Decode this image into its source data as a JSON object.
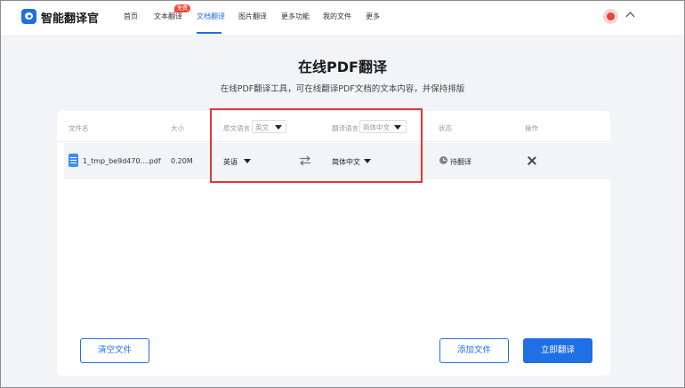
{
  "header": {
    "logo": "智能翻译官",
    "nav": [
      {
        "label": "首页"
      },
      {
        "label": "文本翻译"
      },
      {
        "label": "文档翻译"
      },
      {
        "label": "图片翻译"
      },
      {
        "label": "更多功能"
      },
      {
        "label": "我的文件"
      },
      {
        "label": "更多"
      }
    ],
    "badge": "免费"
  },
  "page": {
    "title": "在线PDF翻译",
    "subtitle": "在线PDF翻译工具，可在线翻译PDF文档的文本内容，并保持排版"
  },
  "table": {
    "headers": {
      "filename": "文件名",
      "size": "大小",
      "source_lang": "原文语言",
      "target_lang": "翻译语言",
      "status": "状态",
      "action": "操作"
    },
    "header_source_select": "英文",
    "header_target_select": "简体中文",
    "rows": [
      {
        "filename": "1_tmp_be9d470....pdf",
        "size": "0.20M",
        "source_lang": "英语",
        "target_lang": "简体中文",
        "status": "待翻译"
      }
    ]
  },
  "buttons": {
    "clear": "清空文件",
    "add": "添加文件",
    "translate": "立即翻译"
  },
  "colors": {
    "accent": "#1f6fe5",
    "highlight": "#e53535",
    "badge": "#f0493b"
  }
}
